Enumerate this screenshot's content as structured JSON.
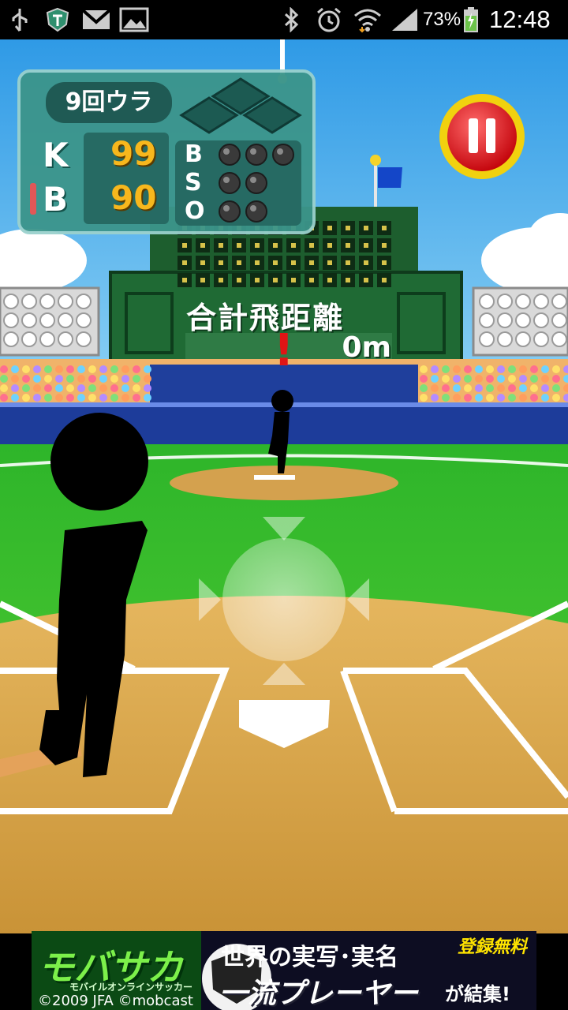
{
  "status_bar": {
    "battery_percent": "73%",
    "time": "12:48",
    "icons": [
      "usb-icon",
      "vpn-shield-icon",
      "gmail-icon",
      "gallery-icon",
      "bluetooth-icon",
      "alarm-icon",
      "wifi-icon",
      "signal-icon",
      "battery-icon"
    ]
  },
  "scoreboard": {
    "inning": "9回ウラ",
    "k_label": "K",
    "k_value": "99",
    "b_label": "B",
    "b_value": "90",
    "count_labels": [
      "B",
      "S",
      "O"
    ],
    "lamps": {
      "balls": 3,
      "strikes": 2,
      "outs": 2
    }
  },
  "distance": {
    "label": "合計飛距離",
    "value": "0m"
  },
  "alert_mark": "!",
  "ad": {
    "brand": "モバサカ",
    "brand_sub": "モバイルオンラインサッカー",
    "headline": "世界の実写･実名",
    "tagline_big": "一流プレーヤー",
    "tagline_small": "が結集!",
    "badge": "登録無料",
    "copyright": "©2009 JFA ©mobcast"
  },
  "colors": {
    "sky": "#3fa7e8",
    "grass": "#3cc22a",
    "dirt": "#d9a94e",
    "scoreboard_bg": "#2e7d74",
    "number_gold": "#f7b71d",
    "pause_red": "#e4141c"
  }
}
